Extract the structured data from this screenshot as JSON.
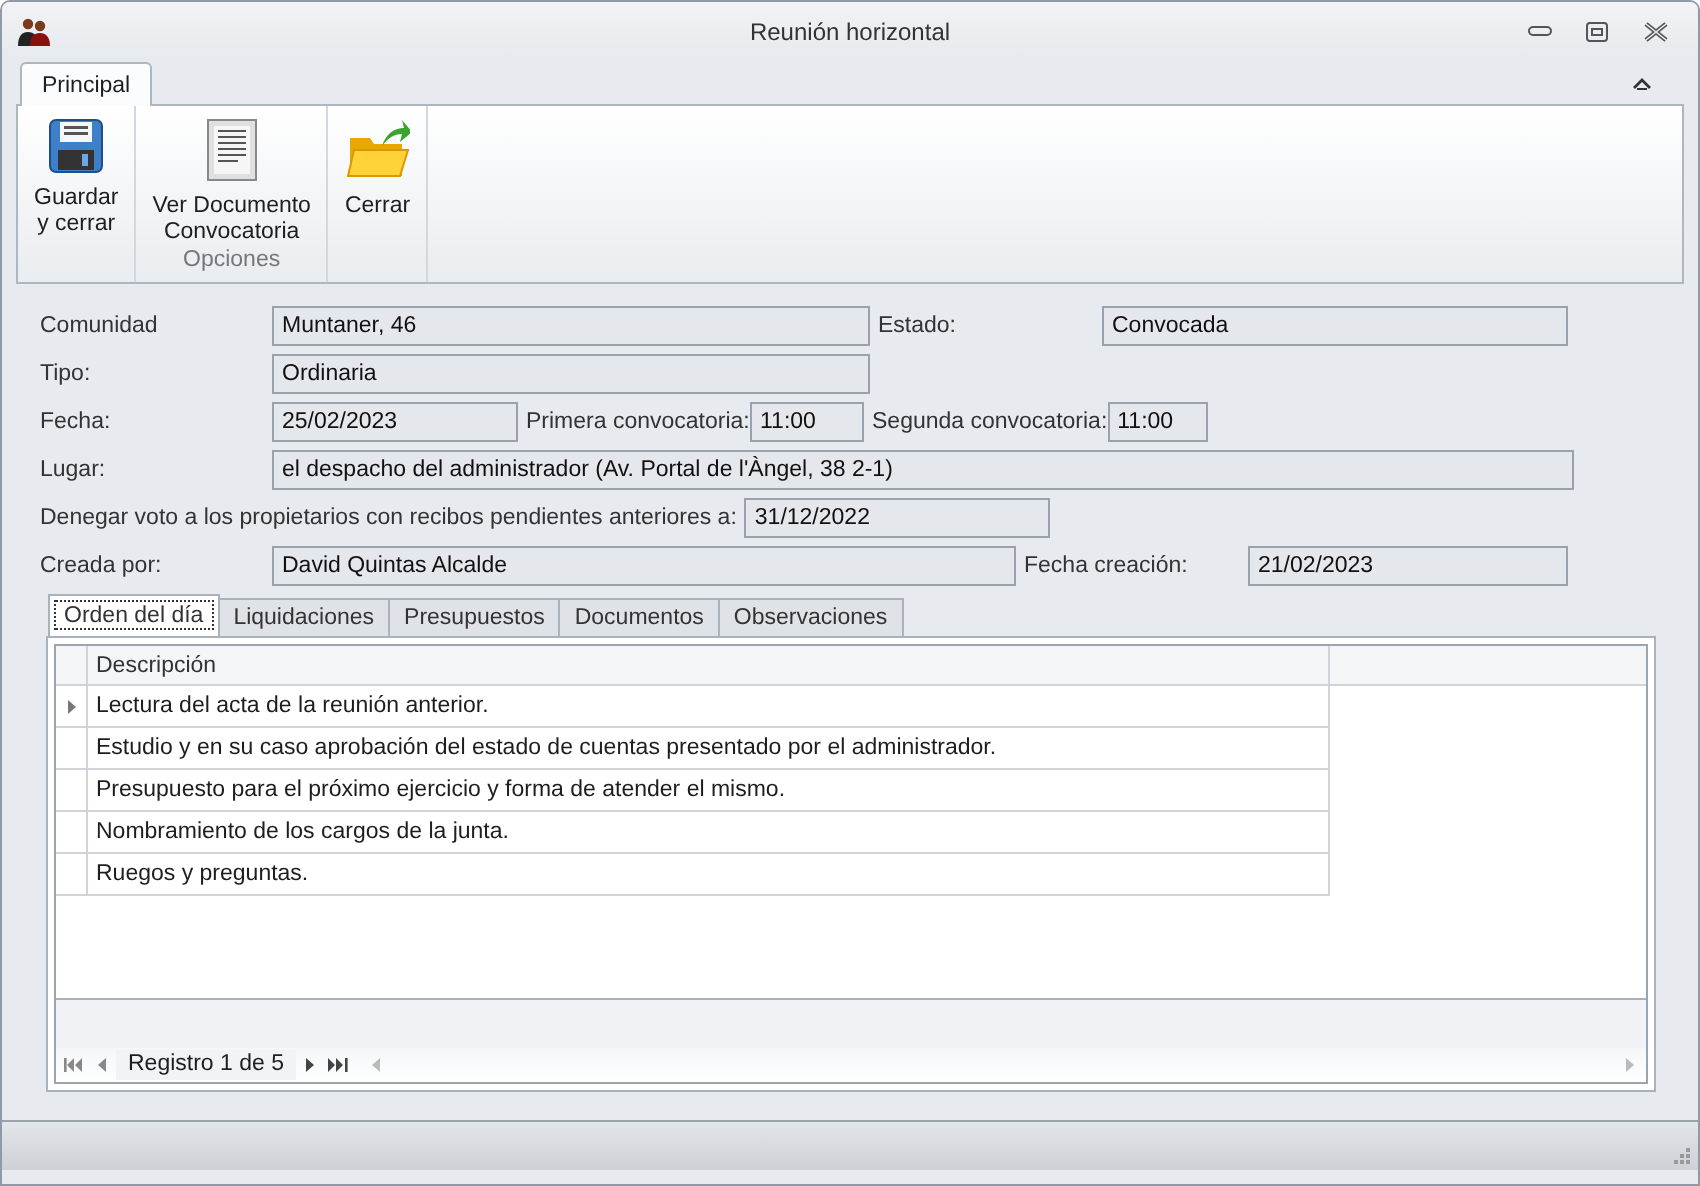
{
  "window": {
    "title": "Reunión horizontal"
  },
  "ribbon": {
    "tabs": [
      {
        "label": "Principal",
        "selected": true
      }
    ],
    "groups": [
      {
        "buttons": [
          {
            "label": "Guardar\ny cerrar",
            "kind": "save"
          }
        ]
      },
      {
        "caption": "Opciones",
        "buttons": [
          {
            "label": "Ver Documento\nConvocatoria",
            "kind": "document"
          }
        ]
      },
      {
        "buttons": [
          {
            "label": "Cerrar",
            "kind": "close-folder"
          }
        ]
      }
    ]
  },
  "form": {
    "comunidad": {
      "label": "Comunidad",
      "value": "Muntaner, 46"
    },
    "estado": {
      "label": "Estado:",
      "value": "Convocada"
    },
    "tipo": {
      "label": "Tipo:",
      "value": "Ordinaria"
    },
    "fecha": {
      "label": "Fecha:",
      "value": "25/02/2023"
    },
    "primera": {
      "label": "Primera convocatoria:",
      "value": "11:00"
    },
    "segunda": {
      "label": "Segunda convocatoria:",
      "value": "11:00"
    },
    "lugar": {
      "label": "Lugar:",
      "value": "el despacho del administrador (Av. Portal de l'Àngel, 38 2-1)"
    },
    "denegar": {
      "label": "Denegar voto a los propietarios con recibos pendientes anteriores a:",
      "value": "31/12/2022"
    },
    "creada": {
      "label": "Creada por:",
      "value": "David Quintas Alcalde"
    },
    "fecha_creacion": {
      "label": "Fecha creación:",
      "value": "21/02/2023"
    }
  },
  "tabs": [
    {
      "label": "Orden del día",
      "selected": true
    },
    {
      "label": "Liquidaciones",
      "selected": false
    },
    {
      "label": "Presupuestos",
      "selected": false
    },
    {
      "label": "Documentos",
      "selected": false
    },
    {
      "label": "Observaciones",
      "selected": false
    }
  ],
  "grid": {
    "columns": [
      "Descripción"
    ],
    "rows": [
      {
        "cells": [
          "Lectura del acta de la reunión anterior."
        ],
        "current": true
      },
      {
        "cells": [
          "Estudio y en su caso aprobación del estado de cuentas presentado por el administrador."
        ],
        "current": false
      },
      {
        "cells": [
          "Presupuesto para el próximo ejercicio y forma de atender el mismo."
        ],
        "current": false
      },
      {
        "cells": [
          "Nombramiento de los cargos de la junta."
        ],
        "current": false
      },
      {
        "cells": [
          "Ruegos y preguntas."
        ],
        "current": false
      }
    ],
    "navigator": "Registro 1 de 5"
  }
}
